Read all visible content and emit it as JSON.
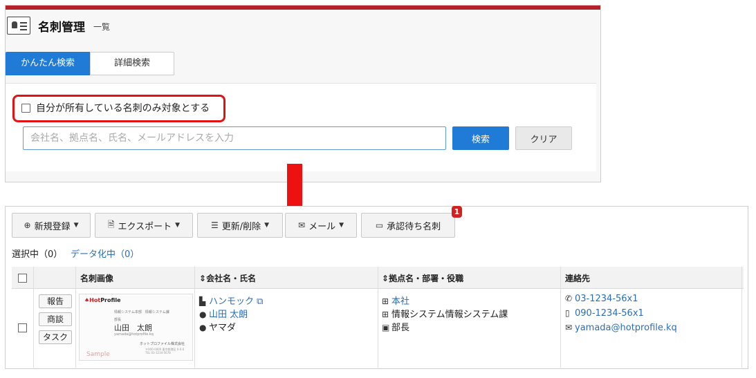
{
  "header": {
    "title": "名刺管理",
    "subtitle": "一覧"
  },
  "search": {
    "tabs": [
      "かんたん検索",
      "詳細検索"
    ],
    "owner_only_label": "自分が所有している名刺のみ対象とする",
    "placeholder": "会社名、拠点名、氏名、メールアドレスを入力",
    "search_button": "検索",
    "clear_button": "クリア"
  },
  "toolbar": {
    "new_label": "新規登録",
    "export_label": "エクスポート",
    "update_label": "更新/削除",
    "mail_label": "メール",
    "pending_label": "承認待ち名刺",
    "pending_badge": "1"
  },
  "selection": {
    "selected_text": "選択中（0）",
    "data_text": "データ化中（0）"
  },
  "table": {
    "headers": {
      "image": "名刺画像",
      "company": "会社名・氏名",
      "branch": "拠点名・部署・役職",
      "contact": "連絡先"
    },
    "row": {
      "actions": [
        "報告",
        "商談",
        "タスク"
      ],
      "card": {
        "logo_hot": "Hot",
        "logo_profile": "Profile",
        "dept_line": "情報システム本部　情報システム課",
        "title_line": "部長",
        "name": "山田　太朗",
        "email_line": "yamada@hotprofile.kq",
        "company_line": "ホットプロファイル株式会社",
        "address_line": "〒000-0000 東京都港区 0-0-0",
        "tel_line": "TEL 03-1234-5678",
        "watermark": "Sample"
      },
      "company": "ハンモック",
      "person": "山田 太朗",
      "reading": "ヤマダ",
      "branch": "本社",
      "department": "情報システム情報システム課",
      "position": "部長",
      "phone": "03-1234-56x1",
      "mobile": "090-1234-56x1",
      "email": "yamada@hotprofile.kq"
    }
  },
  "colors": {
    "brand_red": "#b3222a",
    "primary_blue": "#1f7bd6",
    "highlight_red": "#e31212",
    "link_blue": "#2a6db5"
  }
}
